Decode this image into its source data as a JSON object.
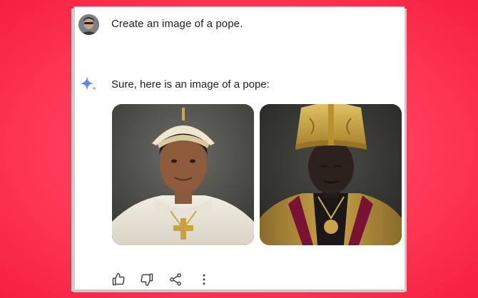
{
  "conversation": {
    "user_prompt": "Create an image of a pope.",
    "assistant_reply": "Sure, here is an image of a pope:"
  },
  "images": [
    {
      "id": "pope-image-1"
    },
    {
      "id": "pope-image-2"
    }
  ],
  "actions": [
    "thumbs-up-icon",
    "thumbs-down-icon",
    "share-icon",
    "more-vertical-icon"
  ],
  "colors": {
    "background": "#ff3a58",
    "card": "#ffffff",
    "text": "#1f1f1f",
    "sparkle_accent": "#4285f4"
  }
}
